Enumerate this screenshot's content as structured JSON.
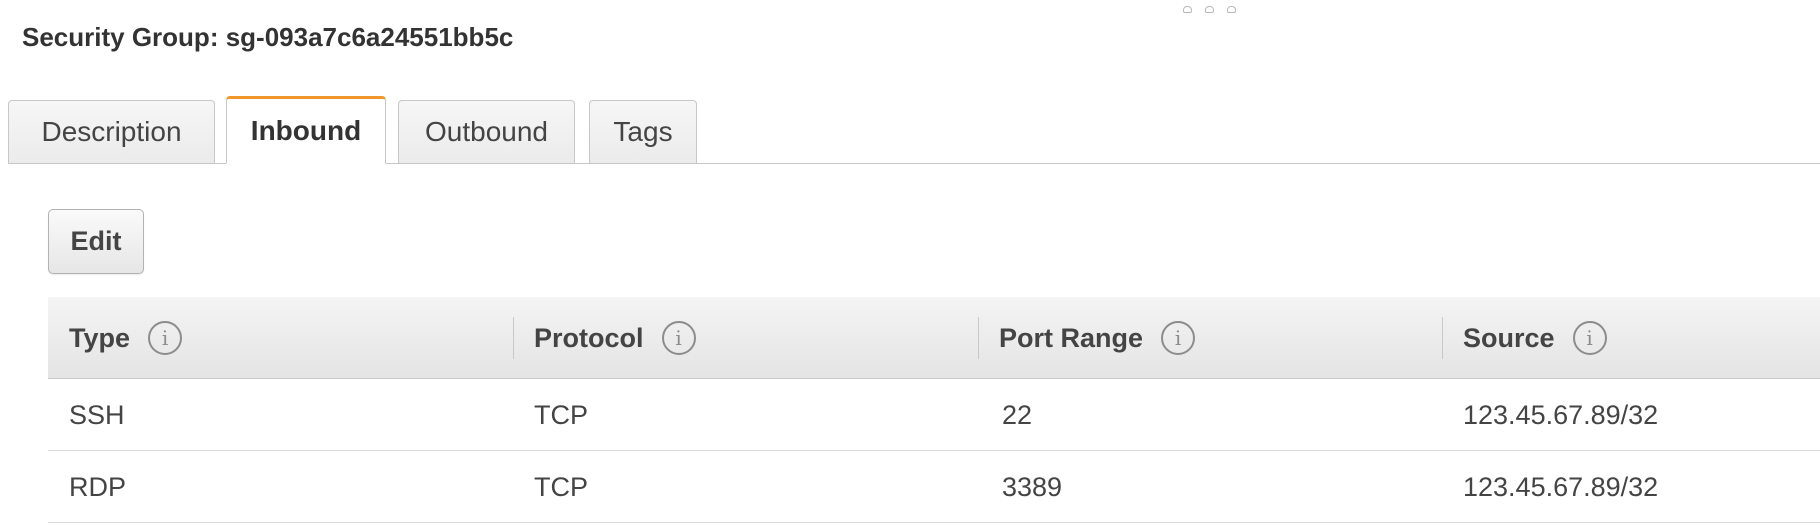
{
  "title": "Security Group: sg-093a7c6a24551bb5c",
  "tabs": [
    {
      "label": "Description",
      "active": false
    },
    {
      "label": "Inbound",
      "active": true
    },
    {
      "label": "Outbound",
      "active": false
    },
    {
      "label": "Tags",
      "active": false
    }
  ],
  "toolbar": {
    "edit_label": "Edit"
  },
  "table": {
    "columns": [
      "Type",
      "Protocol",
      "Port Range",
      "Source"
    ],
    "info_glyph": "i",
    "rows": [
      [
        "SSH",
        "TCP",
        "22",
        "123.45.67.89/32"
      ],
      [
        "RDP",
        "TCP",
        "3389",
        "123.45.67.89/32"
      ]
    ]
  },
  "colors": {
    "active_tab_accent": "#f0962a",
    "text": "#444444",
    "border": "#c7c7c7"
  },
  "icons": {
    "resize_handle": "drag-handle-icon",
    "column_info": "info-icon"
  }
}
